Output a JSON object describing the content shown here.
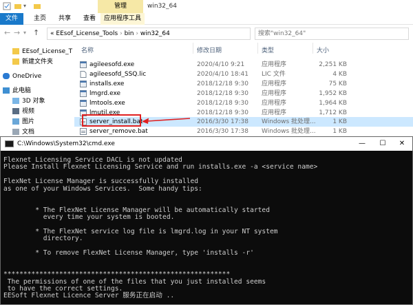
{
  "titlebar": {
    "context_tab": "管理",
    "window_title": "win32_64"
  },
  "ribbon": {
    "tabs": [
      "文件",
      "主页",
      "共享",
      "查看",
      "应用程序工具"
    ]
  },
  "address": {
    "chevron": "«",
    "path": [
      "EEsof_License_Tools",
      "bin",
      "win32_64"
    ],
    "search_placeholder": "搜索\"win32_64\""
  },
  "nav_pane": {
    "items": [
      {
        "label": "EEsof_License_T",
        "icon": "folder-icon"
      },
      {
        "label": "新建文件夹",
        "icon": "folder-icon"
      },
      {
        "label": "OneDrive",
        "icon": "cloud-icon"
      },
      {
        "label": "此电脑",
        "icon": "computer-icon"
      },
      {
        "label": "3D 对象",
        "icon": "cube-icon"
      },
      {
        "label": "视频",
        "icon": "video-icon"
      },
      {
        "label": "图片",
        "icon": "picture-icon"
      },
      {
        "label": "文档",
        "icon": "document-icon"
      }
    ]
  },
  "file_list": {
    "headers": {
      "name": "名称",
      "date": "修改日期",
      "type": "类型",
      "size": "大小"
    },
    "rows": [
      {
        "name": "agileesofd.exe",
        "date": "2020/4/10 9:21",
        "type": "应用程序",
        "size": "2,251 KB",
        "icon": "exe-icon"
      },
      {
        "name": "agileesofd_SSQ.lic",
        "date": "2020/4/10 18:41",
        "type": "LIC 文件",
        "size": "4 KB",
        "icon": "file-icon"
      },
      {
        "name": "installs.exe",
        "date": "2018/12/18 9:30",
        "type": "应用程序",
        "size": "75 KB",
        "icon": "exe-icon"
      },
      {
        "name": "lmgrd.exe",
        "date": "2018/12/18 9:30",
        "type": "应用程序",
        "size": "1,952 KB",
        "icon": "exe-icon"
      },
      {
        "name": "lmtools.exe",
        "date": "2018/12/18 9:30",
        "type": "应用程序",
        "size": "1,964 KB",
        "icon": "exe-icon"
      },
      {
        "name": "lmutil.exe",
        "date": "2018/12/18 9:30",
        "type": "应用程序",
        "size": "1,712 KB",
        "icon": "exe-icon"
      },
      {
        "name": "server_install.bat",
        "date": "2016/3/30 17:38",
        "type": "Windows 批处理...",
        "size": "1 KB",
        "icon": "bat-icon"
      },
      {
        "name": "server_remove.bat",
        "date": "2016/3/30 17:38",
        "type": "Windows 批处理...",
        "size": "1 KB",
        "icon": "bat-icon"
      }
    ]
  },
  "cmd": {
    "title": "C:\\Windows\\System32\\cmd.exe",
    "lines": [
      "Flexnet Licensing Service DACL is not updated",
      "Please Install Flexnet Licensing Service and run installs.exe -a <service name>",
      "",
      "FlexNet License Manager is successfully installed",
      "as one of your Windows Services.  Some handy tips:",
      "",
      "",
      "        * The FlexNet License Manager will be automatically started",
      "          every time your system is booted.",
      "",
      "        * The FlexNet service log file is lmgrd.log in your NT system",
      "          directory.",
      "",
      "        * To remove FlexNet License Manager, type 'installs -r'",
      "",
      "",
      "*********************************************************",
      " The permissions of one of the files that you just installed seems",
      " to have the correct settings.",
      "EESoft Flexnet Licence Server 服务正在启动 ..",
      ""
    ]
  },
  "colors": {
    "accent": "#1979ca",
    "highlight": "#e02020",
    "context_tab": "#f6e8a6"
  }
}
